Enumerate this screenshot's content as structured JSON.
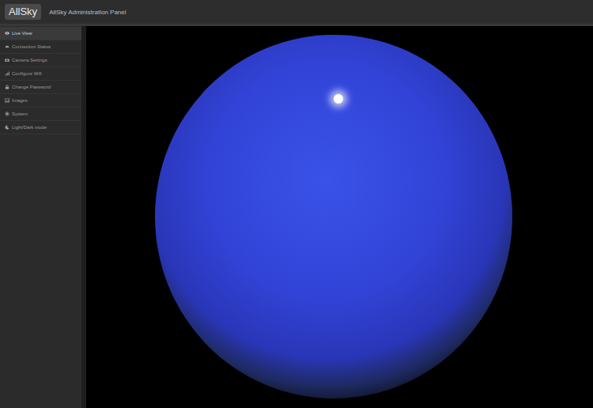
{
  "header": {
    "logo": "AllSky",
    "title": "AllSky Administration Panel"
  },
  "sidebar": {
    "items": [
      {
        "label": "Live View",
        "selected": true
      },
      {
        "label": "Connection Status",
        "selected": false
      },
      {
        "label": "Camera Settings",
        "selected": false
      },
      {
        "label": "Configure Wifi",
        "selected": false
      },
      {
        "label": "Change Password",
        "selected": false
      },
      {
        "label": "Images",
        "selected": false
      },
      {
        "label": "System",
        "selected": false
      },
      {
        "label": "Light/Dark mode",
        "selected": false
      }
    ]
  }
}
